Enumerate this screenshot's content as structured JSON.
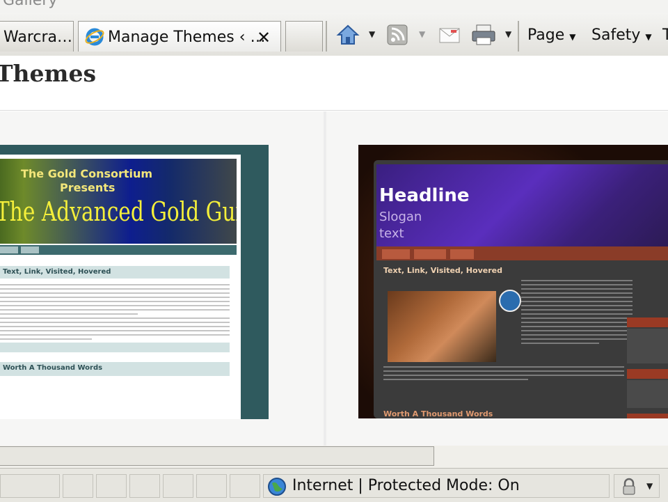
{
  "window": {
    "title": "Gallery"
  },
  "tabs": [
    {
      "label": "Warcra…"
    },
    {
      "label": "Manage Themes ‹ …",
      "close": "✕",
      "icon": "ie-icon"
    },
    {
      "label": ""
    }
  ],
  "toolbar": {
    "page_label": "Page",
    "safety_label": "Safety",
    "more_label": "T",
    "icons": [
      "home-icon",
      "feeds-icon",
      "read-mail-icon",
      "print-icon"
    ]
  },
  "page": {
    "title": "Themes"
  },
  "themes": [
    {
      "banner_line1": "The Gold Consortium",
      "banner_line2": "Presents",
      "banner_title": "The Advanced Gold Guide",
      "post_title": "Text, Link, Visited, Hovered",
      "second_post": "Worth A Thousand Words"
    },
    {
      "headline": "Headline",
      "slogan": "Slogan text",
      "post_title": "Text, Link, Visited, Hovered",
      "second_post": "Worth A Thousand Words"
    }
  ],
  "status": {
    "zone": "Internet | Protected Mode: On",
    "zone_icon": "globe-icon",
    "security_icon": "lock-icon"
  },
  "colors": {
    "theme1_frame": "#2f5a5e",
    "theme2_header": "#5a2ebd",
    "theme2_nav": "#8a3c28"
  }
}
